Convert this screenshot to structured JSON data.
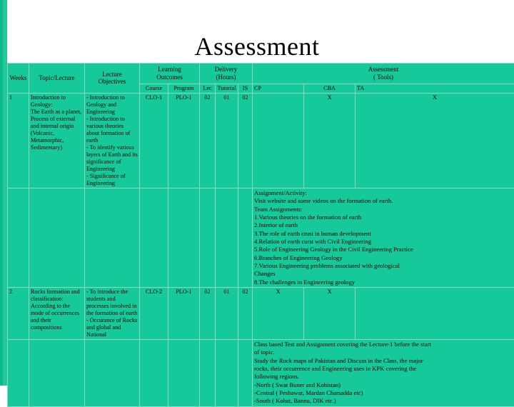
{
  "slide": {
    "title": "Assessment"
  },
  "table": {
    "headers": {
      "week": "Weeks",
      "topic": "Topic/Lecture",
      "objectives_line1": "Lecture",
      "objectives_line2": "Objectives",
      "outcomes_line1": "Learning",
      "outcomes_line2": "Outcomes",
      "delivery_line1": "Delivery",
      "delivery_line2": "(Hours)",
      "assessment_line1": "Assessment",
      "assessment_line2": "( Tools)"
    },
    "subheaders": {
      "course": "Course",
      "program": "Program",
      "lec": "Lec",
      "tutorial": "Tutorial",
      "is": "IS",
      "cp": "CP",
      "cba": "CBA",
      "ta": "TA"
    },
    "rows": [
      {
        "week": "1",
        "topic": "Introduction to Geology:\nThe Earth as a planet, Process of external and internal origin (Volcanic, Metamorphic, Sedimentary)",
        "objectives": "- Introduction to Geology and Engineering\n- Introduction to various theories about formation of earth\n- To identify various layers of Earth and its significance of Engineering\n- Significance of Engineering",
        "course_outcome": "CLO-1",
        "program_outcome": "PLO-1",
        "lec": "02",
        "tutorial": "01",
        "is": "02",
        "cp": "",
        "cba": "X",
        "ta": "X",
        "assessment_detail": [
          "Assignment/Activity:",
          "Visit website and some videos on the formation of earth.",
          "Team Assignments:",
          "1.Various theories on the formation of earth",
          "2.Interior of earth",
          "3.The role of earth crust in human development",
          "4.Relation of earth curst with Civil Engineering",
          "5.Role of Engineering Geology in the Civil Engineering Practice",
          "6.Branches of Engineering Geology",
          "7.Various Engineering problems associated with geological",
          "Changes",
          "8.The challenges in Engineering geology"
        ]
      },
      {
        "week": "2",
        "topic": "Rocks formation and classification: According to the mode of occurrences and their compositions",
        "objectives": "- To introduce the students and processes involved in the formation of earth\n- Occurance of Rocks and global and National",
        "course_outcome": "CLO-2",
        "program_outcome": "PLO-1",
        "lec": "02",
        "tutorial": "01",
        "is": "02",
        "cp": "X",
        "cba": "X",
        "ta": "",
        "assessment_detail": [
          "Class based Test and Assignment covering the Lecture-1 before the start",
          "of topic.",
          "Study the Rock maps of Pakistan and Discuss in the Class, the major",
          "rocks, their occurrence and Engineering uses in KPK covering the",
          "following regions.",
          "-North ( Swat Buner and Kohistan)",
          "-Central ( Peshawar, Mardan Charsadda etc)",
          "-South ( Kohat, Bannu, DIK etc.)"
        ]
      }
    ]
  }
}
